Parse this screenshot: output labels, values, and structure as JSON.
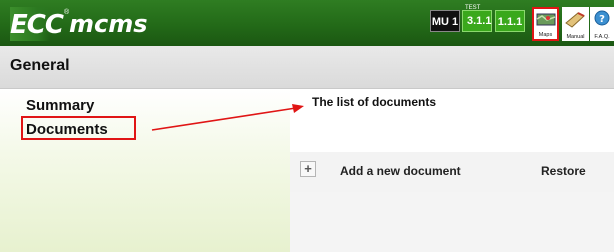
{
  "header": {
    "logo_main": "ECC",
    "logo_reg": "®",
    "logo_sub": "mcms",
    "badges": {
      "mu": "MU 1",
      "test_small": "TEST",
      "test_version": "3.1.1",
      "version": "1.1.1"
    },
    "tools": {
      "maps": "Maps",
      "manual": "Manual",
      "faq": "F.A.Q."
    }
  },
  "section": {
    "title": "General"
  },
  "sidebar": {
    "items": [
      {
        "label": "Summary"
      },
      {
        "label": "Documents"
      }
    ]
  },
  "main": {
    "list_title": "The list of documents",
    "add_button_symbol": "+",
    "add_label": "Add a new document",
    "restore_label": "Restore"
  },
  "colors": {
    "header_green": "#236a18",
    "badge_green": "#3aa81c",
    "highlight_red": "#e01515",
    "sidebar_tint": "#e7f1cf"
  }
}
